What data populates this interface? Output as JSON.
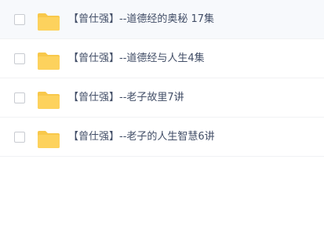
{
  "colors": {
    "folder_back": "#f8c84b",
    "folder_front": "#fdd25d",
    "text": "#424e67",
    "divider": "#f1f2f4",
    "checkbox_border": "#c8cbd1"
  },
  "file_list": {
    "items": [
      {
        "name": "【曾仕强】--道德经的奥秘 17集",
        "icon": "folder-icon",
        "checked": false
      },
      {
        "name": "【曾仕强】--道德经与人生4集",
        "icon": "folder-icon",
        "checked": false
      },
      {
        "name": "【曾仕强】--老子故里7讲",
        "icon": "folder-icon",
        "checked": false
      },
      {
        "name": "【曾仕强】--老子的人生智慧6讲",
        "icon": "folder-icon",
        "checked": false
      }
    ]
  }
}
